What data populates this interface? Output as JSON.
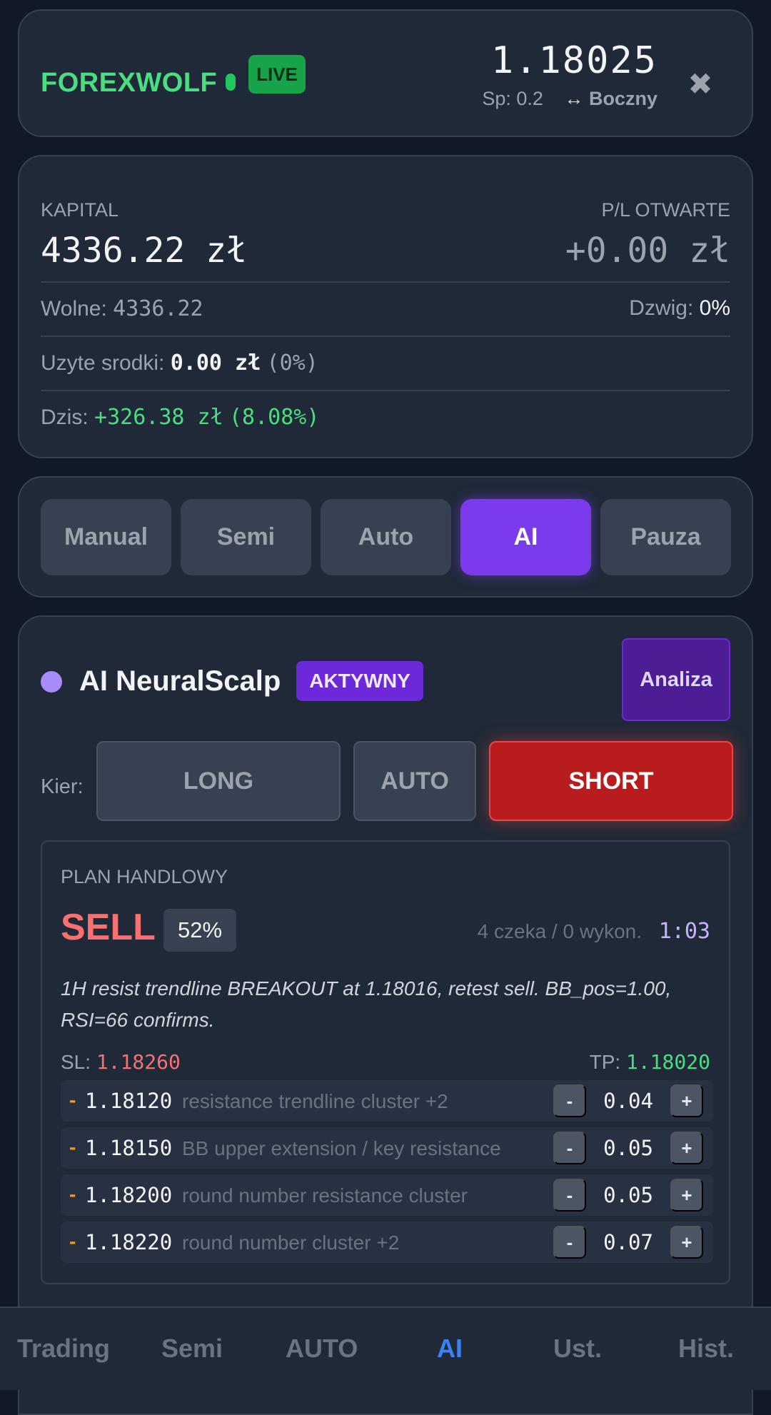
{
  "header": {
    "brand": "FOREXWOLF",
    "live_badge": "LIVE",
    "price": "1.18025",
    "spread_label": "Sp: 0.2",
    "trend_arrow": "↔",
    "trend_label": "Boczny",
    "close_icon": "✖"
  },
  "account": {
    "capital_label": "KAPITAL",
    "capital_value": "4336.22 zł",
    "pl_label": "P/L OTWARTE",
    "pl_value": "+0.00 zł",
    "free_label": "Wolne:",
    "free_value": "4336.22",
    "leverage_label": "Dzwig:",
    "leverage_value": "0%",
    "used_label": "Uzyte srodki:",
    "used_value": "0.00 zł",
    "used_pct": "(0%)",
    "today_label": "Dzis:",
    "today_value": "+326.38 zł",
    "today_pct": "(8.08%)"
  },
  "modes": [
    "Manual",
    "Semi",
    "Auto",
    "AI",
    "Pauza"
  ],
  "active_mode": "AI",
  "strategy": {
    "title": "AI NeuralScalp",
    "status_badge": "AKTYWNY",
    "analyze_button": "Analiza",
    "direction_label": "Kier:",
    "directions": {
      "long": "LONG",
      "auto": "AUTO",
      "short": "SHORT"
    },
    "selected_direction": "SHORT"
  },
  "plan": {
    "label": "PLAN HANDLOWY",
    "signal": "SELL",
    "confidence": "52%",
    "orders_status": "4 czeka / 0 wykon.",
    "timer": "1:03",
    "reason": "1H resist trendline BREAKOUT at 1.18016, retest sell. BB_pos=1.00, RSI=66 confirms.",
    "sl_label": "SL:",
    "sl_value": "1.18260",
    "tp_label": "TP:",
    "tp_value": "1.18020",
    "levels": [
      {
        "dash": "-",
        "price": "1.18120",
        "desc": "resistance trendline cluster +2",
        "minus": "-",
        "lot": "0.04",
        "plus": "+"
      },
      {
        "dash": "-",
        "price": "1.18150",
        "desc": "BB upper extension / key resistance",
        "minus": "-",
        "lot": "0.05",
        "plus": "+"
      },
      {
        "dash": "-",
        "price": "1.18200",
        "desc": "round number resistance cluster",
        "minus": "-",
        "lot": "0.05",
        "plus": "+"
      },
      {
        "dash": "-",
        "price": "1.18220",
        "desc": "round number cluster +2",
        "minus": "-",
        "lot": "0.07",
        "plus": "+"
      }
    ]
  },
  "nav": [
    "Trading",
    "Semi",
    "AUTO",
    "AI",
    "Ust.",
    "Hist."
  ],
  "active_nav": "AI",
  "colors": {
    "background": "#111827",
    "card": "#1f2937",
    "accent_purple": "#7c3aed",
    "positive": "#4ade80",
    "negative": "#f87171",
    "active_nav": "#3b82f6"
  }
}
